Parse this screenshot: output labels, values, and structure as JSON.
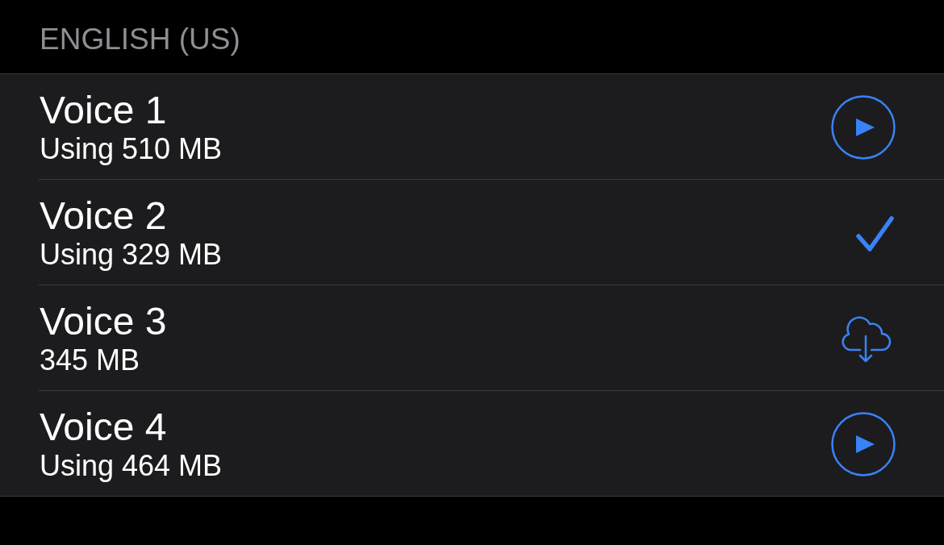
{
  "section": {
    "title": "ENGLISH (US)"
  },
  "voices": [
    {
      "name": "Voice 1",
      "size": "Using 510 MB",
      "selected": false,
      "kind": "installed"
    },
    {
      "name": "Voice 2",
      "size": "Using 329 MB",
      "selected": true
    },
    {
      "name": "Voice 3",
      "size": "345 MB",
      "selected": false,
      "kind": "available"
    },
    {
      "name": "Voice 4",
      "size": "Using 464 MB",
      "selected": false,
      "kind": "installed"
    }
  ]
}
